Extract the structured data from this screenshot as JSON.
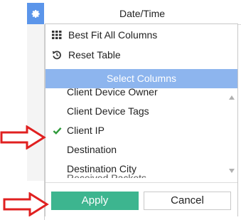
{
  "header": {
    "column_title": "Date/Time",
    "settings_icon": "gear-icon"
  },
  "menu": {
    "best_fit_label": "Best Fit All Columns",
    "best_fit_icon": "grid-icon",
    "reset_label": "Reset Table",
    "reset_icon": "reset-icon",
    "select_columns_header": "Select Columns",
    "columns": [
      {
        "label": "Client Device Owner",
        "checked": false
      },
      {
        "label": "Client Device Tags",
        "checked": false
      },
      {
        "label": "Client IP",
        "checked": true
      },
      {
        "label": "Destination",
        "checked": false
      },
      {
        "label": "Destination City",
        "checked": false
      },
      {
        "label": "Received Packets",
        "checked": false
      }
    ],
    "apply_label": "Apply",
    "cancel_label": "Cancel"
  },
  "colors": {
    "accent": "#5b95ea",
    "select_header": "#8db5ee",
    "apply": "#3db58f",
    "check": "#2e9a3a",
    "annotation_arrow": "#e02020"
  }
}
